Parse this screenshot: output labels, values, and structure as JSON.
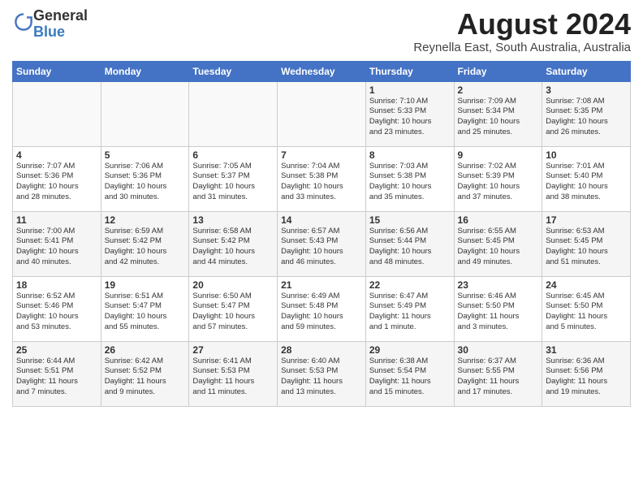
{
  "header": {
    "logo": {
      "line1": "General",
      "line2": "Blue"
    },
    "title": "August 2024",
    "subtitle": "Reynella East, South Australia, Australia"
  },
  "weekdays": [
    "Sunday",
    "Monday",
    "Tuesday",
    "Wednesday",
    "Thursday",
    "Friday",
    "Saturday"
  ],
  "weeks": [
    [
      {
        "day": "",
        "info": ""
      },
      {
        "day": "",
        "info": ""
      },
      {
        "day": "",
        "info": ""
      },
      {
        "day": "",
        "info": ""
      },
      {
        "day": "1",
        "info": "Sunrise: 7:10 AM\nSunset: 5:33 PM\nDaylight: 10 hours\nand 23 minutes."
      },
      {
        "day": "2",
        "info": "Sunrise: 7:09 AM\nSunset: 5:34 PM\nDaylight: 10 hours\nand 25 minutes."
      },
      {
        "day": "3",
        "info": "Sunrise: 7:08 AM\nSunset: 5:35 PM\nDaylight: 10 hours\nand 26 minutes."
      }
    ],
    [
      {
        "day": "4",
        "info": "Sunrise: 7:07 AM\nSunset: 5:36 PM\nDaylight: 10 hours\nand 28 minutes."
      },
      {
        "day": "5",
        "info": "Sunrise: 7:06 AM\nSunset: 5:36 PM\nDaylight: 10 hours\nand 30 minutes."
      },
      {
        "day": "6",
        "info": "Sunrise: 7:05 AM\nSunset: 5:37 PM\nDaylight: 10 hours\nand 31 minutes."
      },
      {
        "day": "7",
        "info": "Sunrise: 7:04 AM\nSunset: 5:38 PM\nDaylight: 10 hours\nand 33 minutes."
      },
      {
        "day": "8",
        "info": "Sunrise: 7:03 AM\nSunset: 5:38 PM\nDaylight: 10 hours\nand 35 minutes."
      },
      {
        "day": "9",
        "info": "Sunrise: 7:02 AM\nSunset: 5:39 PM\nDaylight: 10 hours\nand 37 minutes."
      },
      {
        "day": "10",
        "info": "Sunrise: 7:01 AM\nSunset: 5:40 PM\nDaylight: 10 hours\nand 38 minutes."
      }
    ],
    [
      {
        "day": "11",
        "info": "Sunrise: 7:00 AM\nSunset: 5:41 PM\nDaylight: 10 hours\nand 40 minutes."
      },
      {
        "day": "12",
        "info": "Sunrise: 6:59 AM\nSunset: 5:42 PM\nDaylight: 10 hours\nand 42 minutes."
      },
      {
        "day": "13",
        "info": "Sunrise: 6:58 AM\nSunset: 5:42 PM\nDaylight: 10 hours\nand 44 minutes."
      },
      {
        "day": "14",
        "info": "Sunrise: 6:57 AM\nSunset: 5:43 PM\nDaylight: 10 hours\nand 46 minutes."
      },
      {
        "day": "15",
        "info": "Sunrise: 6:56 AM\nSunset: 5:44 PM\nDaylight: 10 hours\nand 48 minutes."
      },
      {
        "day": "16",
        "info": "Sunrise: 6:55 AM\nSunset: 5:45 PM\nDaylight: 10 hours\nand 49 minutes."
      },
      {
        "day": "17",
        "info": "Sunrise: 6:53 AM\nSunset: 5:45 PM\nDaylight: 10 hours\nand 51 minutes."
      }
    ],
    [
      {
        "day": "18",
        "info": "Sunrise: 6:52 AM\nSunset: 5:46 PM\nDaylight: 10 hours\nand 53 minutes."
      },
      {
        "day": "19",
        "info": "Sunrise: 6:51 AM\nSunset: 5:47 PM\nDaylight: 10 hours\nand 55 minutes."
      },
      {
        "day": "20",
        "info": "Sunrise: 6:50 AM\nSunset: 5:47 PM\nDaylight: 10 hours\nand 57 minutes."
      },
      {
        "day": "21",
        "info": "Sunrise: 6:49 AM\nSunset: 5:48 PM\nDaylight: 10 hours\nand 59 minutes."
      },
      {
        "day": "22",
        "info": "Sunrise: 6:47 AM\nSunset: 5:49 PM\nDaylight: 11 hours\nand 1 minute."
      },
      {
        "day": "23",
        "info": "Sunrise: 6:46 AM\nSunset: 5:50 PM\nDaylight: 11 hours\nand 3 minutes."
      },
      {
        "day": "24",
        "info": "Sunrise: 6:45 AM\nSunset: 5:50 PM\nDaylight: 11 hours\nand 5 minutes."
      }
    ],
    [
      {
        "day": "25",
        "info": "Sunrise: 6:44 AM\nSunset: 5:51 PM\nDaylight: 11 hours\nand 7 minutes."
      },
      {
        "day": "26",
        "info": "Sunrise: 6:42 AM\nSunset: 5:52 PM\nDaylight: 11 hours\nand 9 minutes."
      },
      {
        "day": "27",
        "info": "Sunrise: 6:41 AM\nSunset: 5:53 PM\nDaylight: 11 hours\nand 11 minutes."
      },
      {
        "day": "28",
        "info": "Sunrise: 6:40 AM\nSunset: 5:53 PM\nDaylight: 11 hours\nand 13 minutes."
      },
      {
        "day": "29",
        "info": "Sunrise: 6:38 AM\nSunset: 5:54 PM\nDaylight: 11 hours\nand 15 minutes."
      },
      {
        "day": "30",
        "info": "Sunrise: 6:37 AM\nSunset: 5:55 PM\nDaylight: 11 hours\nand 17 minutes."
      },
      {
        "day": "31",
        "info": "Sunrise: 6:36 AM\nSunset: 5:56 PM\nDaylight: 11 hours\nand 19 minutes."
      }
    ]
  ]
}
